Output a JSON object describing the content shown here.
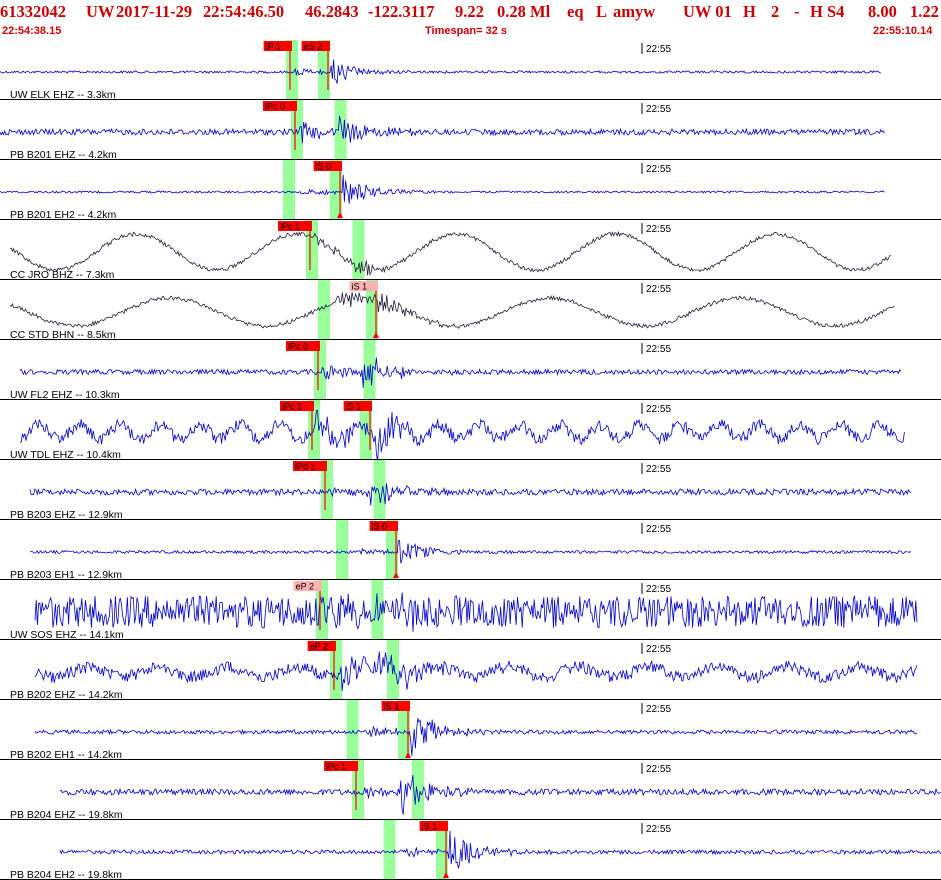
{
  "header": {
    "event_id": "61332042",
    "network": "UW",
    "date": "2017-11-29",
    "origin_time": "22:54:46.50",
    "latitude": "46.2843",
    "longitude": "-122.3117",
    "depth": "9.22",
    "magnitude": "0.28 Ml",
    "event_type": "eq",
    "event_gtype": "L",
    "author": "amyw",
    "source": "UW 01",
    "quality": "H",
    "version": "2",
    "dash": "-",
    "solution": "H S4",
    "rms": "8.00",
    "err": "1.22",
    "start_time": "22:54:38.15",
    "timespan_label": "Timespan=  32 s",
    "end_time": "22:55:10.14"
  },
  "minute_label": "22:55",
  "colors": {
    "title": "#cc0000",
    "trace_blue": "#0000cc",
    "trace_dark": "#202040",
    "pick_red": "#ff0000",
    "pick_pink": "#ffb0b0",
    "window_green": "#99ff99",
    "divider": "#000000"
  },
  "channels": [
    {
      "label": "UW ELK EHZ -- 3.3km",
      "color": "blue",
      "picks": [
        {
          "text": "iP 1",
          "t": 290,
          "style": "red"
        },
        {
          "text": "eS 2",
          "t": 328,
          "style": "red"
        }
      ]
    },
    {
      "label": "PB B201 EHZ -- 4.2km",
      "color": "blue",
      "picks": [
        {
          "text": "iPc 0",
          "t": 295,
          "style": "red"
        }
      ]
    },
    {
      "label": "PB B201 EH2 -- 4.2km",
      "color": "blue",
      "picks": [
        {
          "text": "iS 0",
          "t": 340,
          "style": "red",
          "flag": true
        }
      ]
    },
    {
      "label": "CC JRO BHZ -- 7.3km",
      "color": "dark",
      "picks": [
        {
          "text": "iPc 1",
          "t": 310,
          "style": "red"
        }
      ]
    },
    {
      "label": "CC STD BHN -- 8.5km",
      "color": "dark",
      "picks": [
        {
          "text": "iS 1",
          "t": 376,
          "style": "pink",
          "flag": true
        }
      ]
    },
    {
      "label": "UW FL2 EHZ -- 10.3km",
      "color": "blue",
      "picks": [
        {
          "text": "iPc 0",
          "t": 318,
          "style": "red"
        }
      ]
    },
    {
      "label": "UW TDL EHZ -- 10.4km",
      "color": "blue",
      "picks": [
        {
          "text": "iPc 1",
          "t": 312,
          "style": "red"
        },
        {
          "text": "iS 1",
          "t": 370,
          "style": "red"
        }
      ]
    },
    {
      "label": "PB B203 EHZ -- 12.9km",
      "color": "blue",
      "picks": [
        {
          "text": "iPd 1",
          "t": 325,
          "style": "red"
        }
      ]
    },
    {
      "label": "PB B203 EH1 -- 12.9km",
      "color": "blue",
      "picks": [
        {
          "text": "iS 0",
          "t": 396,
          "style": "red",
          "flag": true
        }
      ]
    },
    {
      "label": "UW SOS EHZ -- 14.1km",
      "color": "blue",
      "picks": [
        {
          "text": "eP 2",
          "t": 320,
          "style": "pink"
        }
      ]
    },
    {
      "label": "PB B202 EHZ -- 14.2km",
      "color": "blue",
      "picks": [
        {
          "text": "eP 2",
          "t": 334,
          "style": "red"
        }
      ]
    },
    {
      "label": "PB B202 EH1 -- 14.2km",
      "color": "blue",
      "picks": [
        {
          "text": "iS 1",
          "t": 408,
          "style": "red",
          "flag": true
        }
      ]
    },
    {
      "label": "PB B204 EHZ -- 19.8km",
      "color": "blue",
      "picks": [
        {
          "text": "iPc 1",
          "t": 356,
          "style": "red"
        }
      ]
    },
    {
      "label": "PB B204 EH2 -- 19.8km",
      "color": "blue",
      "picks": [
        {
          "text": "iS 1",
          "t": 446,
          "style": "red",
          "flag": true
        }
      ]
    }
  ]
}
